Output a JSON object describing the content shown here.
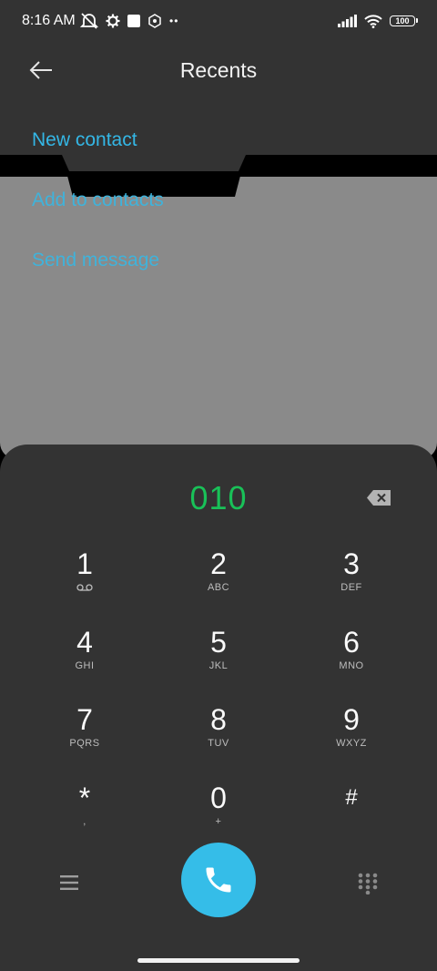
{
  "status_bar": {
    "time": "8:16 AM",
    "left_icons": [
      "mute-alert-icon",
      "settings-gear-icon",
      "square-notification-icon",
      "hex-app-icon",
      "more-dots-icon"
    ],
    "right_icons": [
      "signal-icon",
      "wifi-icon",
      "battery-icon"
    ],
    "battery_level": "100"
  },
  "header": {
    "title": "Recents",
    "back_icon": "arrow-left-icon"
  },
  "actions": {
    "new_contact": "New contact",
    "add_to_contacts": "Add to contacts",
    "send_message": "Send message"
  },
  "dialer": {
    "number": "010",
    "keys": [
      {
        "digit": "1",
        "letters": ""
      },
      {
        "digit": "2",
        "letters": "ABC"
      },
      {
        "digit": "3",
        "letters": "DEF"
      },
      {
        "digit": "4",
        "letters": "GHI"
      },
      {
        "digit": "5",
        "letters": "JKL"
      },
      {
        "digit": "6",
        "letters": "MNO"
      },
      {
        "digit": "7",
        "letters": "PQRS"
      },
      {
        "digit": "8",
        "letters": "TUV"
      },
      {
        "digit": "9",
        "letters": "WXYZ"
      },
      {
        "digit": "*",
        "letters": ","
      },
      {
        "digit": "0",
        "letters": "+"
      },
      {
        "digit": "#",
        "letters": ""
      }
    ]
  },
  "colors": {
    "accent_blue": "#34b7e6",
    "number_green": "#19c158",
    "call_button": "#35bde8",
    "panel_bg": "#333333",
    "overlay_gray": "#8a8a8a"
  }
}
